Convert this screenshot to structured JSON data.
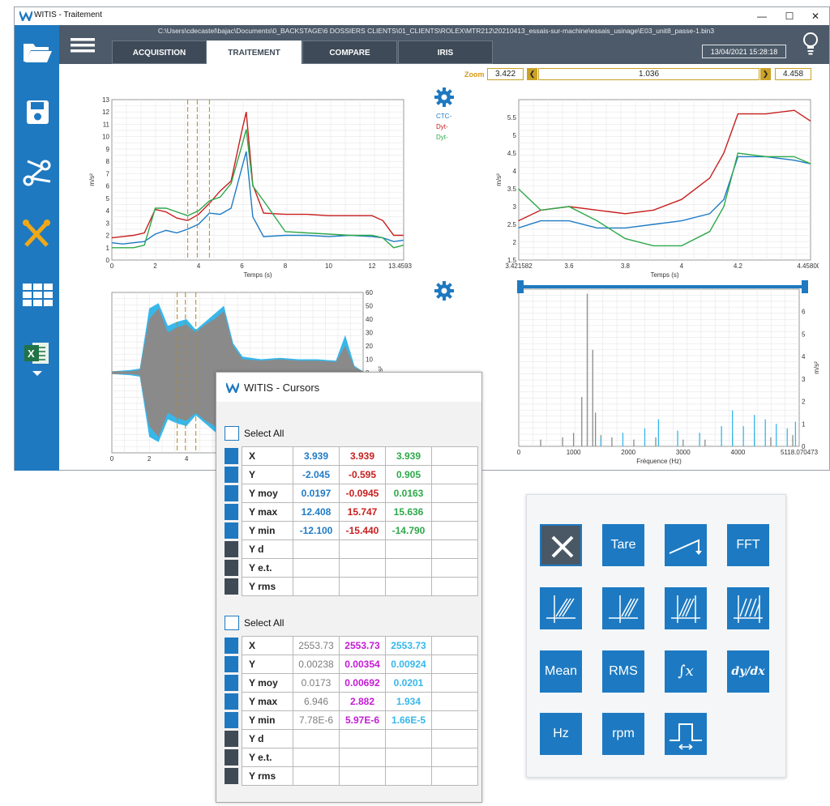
{
  "window": {
    "title": "WITIS - Traitement",
    "path": "C:\\Users\\cdecastel\\bajac\\Documents\\0_BACKSTAGE\\6 DOSSIERS CLIENTS\\01_CLIENTS\\ROLEX\\MTR212\\20210413_essais-sur-machine\\essais_usinage\\E03_unit8_passe-1.bin3",
    "datetime": "13/04/2021 15:28:18",
    "controls": {
      "minimize": "—",
      "maximize": "☐",
      "close": "✕"
    }
  },
  "tabs": [
    {
      "label": "ACQUISITION",
      "active": false
    },
    {
      "label": "TRAITEMENT",
      "active": true
    },
    {
      "label": "COMPARE",
      "active": false
    },
    {
      "label": "IRIS",
      "active": false
    }
  ],
  "sidebar": [
    {
      "icon": "folder-open-icon"
    },
    {
      "icon": "save-icon"
    },
    {
      "icon": "scissors-icon"
    },
    {
      "icon": "tools-icon"
    },
    {
      "icon": "grid-icon"
    },
    {
      "icon": "excel-icon"
    }
  ],
  "zoom": {
    "label": "Zoom",
    "left": "3.422",
    "center": "1.036",
    "right": "4.458"
  },
  "colors": {
    "blue": "#1f7bc6",
    "red": "#c81e1e",
    "green": "#2ea84a",
    "gray": "#8a8a8a",
    "magenta": "#c51ad6",
    "cyan": "#37b7ea",
    "accent": "#1f79c0",
    "gold": "#c9a227"
  },
  "chart_data": [
    {
      "type": "line",
      "name": "time-overview",
      "xlabel": "Temps (s)",
      "ylabel": "m/s²",
      "xlim": [
        0,
        13.459375
      ],
      "ylim": [
        0,
        13
      ],
      "xticks": [
        "0",
        "2",
        "4",
        "6",
        "8",
        "10",
        "12",
        "13.459375"
      ],
      "yticks": [
        "0",
        "1",
        "2",
        "3",
        "4",
        "5",
        "6",
        "7",
        "8",
        "9",
        "10",
        "11",
        "12",
        "13"
      ],
      "legend": [
        "CTC-",
        "Dyt-",
        "Dyt-"
      ],
      "cursor_lines_x": [
        3.5,
        3.939,
        4.5
      ],
      "series": [
        {
          "name": "CTC-",
          "color": "blue",
          "x": [
            0,
            0.5,
            1,
            1.5,
            2,
            2.5,
            3,
            3.5,
            4,
            4.5,
            5,
            5.5,
            6,
            6.2,
            6.5,
            7,
            8,
            9,
            10,
            11,
            12,
            12.5,
            13,
            13.45
          ],
          "y": [
            1.4,
            1.3,
            1.4,
            1.5,
            2.1,
            2.4,
            2.2,
            2.5,
            2.9,
            3.8,
            3.7,
            4.2,
            7.5,
            8.8,
            3.5,
            1.9,
            2.0,
            2.0,
            1.9,
            2.0,
            1.9,
            1.8,
            1.5,
            1.6
          ]
        },
        {
          "name": "Dyt-",
          "color": "red",
          "x": [
            0,
            0.5,
            1,
            1.5,
            2,
            2.5,
            3,
            3.5,
            4,
            4.5,
            5,
            5.5,
            6,
            6.2,
            6.5,
            7,
            8,
            9,
            10,
            11,
            12,
            12.5,
            13,
            13.45
          ],
          "y": [
            1.8,
            1.9,
            2.0,
            2.2,
            4.1,
            3.9,
            3.4,
            3.2,
            3.7,
            4.6,
            5.6,
            6.4,
            10.5,
            12.0,
            6.1,
            3.8,
            3.7,
            3.7,
            3.6,
            3.6,
            3.6,
            3.2,
            2.0,
            2.0
          ]
        },
        {
          "name": "Dyt-",
          "color": "green",
          "x": [
            0,
            0.5,
            1,
            1.5,
            2,
            2.5,
            3,
            3.5,
            4,
            4.5,
            5,
            5.5,
            6,
            6.2,
            6.5,
            7,
            8,
            9,
            10,
            11,
            12,
            12.5,
            13,
            13.45
          ],
          "y": [
            1.0,
            1.0,
            1.0,
            1.2,
            4.2,
            4.2,
            3.9,
            3.6,
            4.0,
            4.8,
            5.1,
            6.2,
            9.3,
            10.6,
            6.0,
            4.8,
            2.3,
            2.2,
            2.1,
            2.0,
            2.0,
            1.8,
            1.0,
            1.2
          ]
        }
      ]
    },
    {
      "type": "line",
      "name": "time-zoom",
      "xlabel": "Temps (s)",
      "ylabel": "m/s²",
      "xlim": [
        3.421582,
        4.458008
      ],
      "ylim": [
        1.5,
        6
      ],
      "xticks": [
        "3.421582",
        "3.6",
        "3.8",
        "4",
        "4.2",
        "4.458008"
      ],
      "yticks": [
        "1.5",
        "2",
        "2.5",
        "3",
        "3.5",
        "4",
        "4.5",
        "5",
        "5.5"
      ],
      "series": [
        {
          "name": "",
          "color": "red",
          "x": [
            3.42,
            3.5,
            3.6,
            3.7,
            3.8,
            3.9,
            4.0,
            4.1,
            4.15,
            4.2,
            4.3,
            4.4,
            4.458
          ],
          "y": [
            2.6,
            2.9,
            3.0,
            2.9,
            2.8,
            2.9,
            3.2,
            3.8,
            4.5,
            5.6,
            5.6,
            5.7,
            5.4
          ]
        },
        {
          "name": "",
          "color": "blue",
          "x": [
            3.42,
            3.5,
            3.6,
            3.7,
            3.8,
            3.9,
            4.0,
            4.1,
            4.15,
            4.2,
            4.3,
            4.4,
            4.458
          ],
          "y": [
            2.4,
            2.6,
            2.6,
            2.4,
            2.4,
            2.5,
            2.6,
            2.8,
            3.2,
            4.4,
            4.4,
            4.3,
            4.2
          ]
        },
        {
          "name": "",
          "color": "green",
          "x": [
            3.42,
            3.5,
            3.6,
            3.7,
            3.8,
            3.9,
            4.0,
            4.1,
            4.15,
            4.2,
            4.3,
            4.4,
            4.458
          ],
          "y": [
            3.5,
            2.9,
            3.0,
            2.6,
            2.1,
            1.9,
            1.9,
            2.3,
            3.0,
            4.5,
            4.4,
            4.4,
            4.2
          ]
        }
      ]
    },
    {
      "type": "area",
      "name": "signal",
      "ylabel": "m/s²",
      "xlim": [
        0,
        13.459375
      ],
      "ylim": [
        -60,
        60
      ],
      "xticks": [
        "0",
        "2",
        "4"
      ],
      "yticks_right": [
        "60",
        "50",
        "40",
        "30",
        "20",
        "10",
        "0",
        "-10"
      ],
      "series": [
        {
          "name": "",
          "color": "cyan",
          "x": [
            0,
            1,
            1.5,
            2,
            2.5,
            3,
            3.5,
            4,
            4.5,
            5,
            5.5,
            6,
            6.5,
            7,
            8,
            9,
            10,
            11,
            12,
            12.5,
            13,
            13.45
          ],
          "y": [
            1,
            2,
            3,
            48,
            52,
            35,
            38,
            40,
            32,
            38,
            44,
            50,
            22,
            12,
            10,
            11,
            10,
            10,
            9,
            28,
            5,
            1
          ]
        },
        {
          "name": "",
          "color": "gray",
          "x": [
            0,
            1,
            1.5,
            2,
            2.5,
            3,
            3.5,
            4,
            4.5,
            5,
            5.5,
            6,
            6.5,
            7,
            8,
            9,
            10,
            11,
            12,
            12.5,
            13,
            13.45
          ],
          "y": [
            1,
            1,
            2,
            40,
            48,
            30,
            34,
            36,
            30,
            36,
            40,
            46,
            20,
            10,
            9,
            10,
            9,
            9,
            8,
            20,
            4,
            1
          ]
        }
      ]
    },
    {
      "type": "bar",
      "name": "spectrum",
      "xlabel": "Fréquence (Hz)",
      "ylabel": "m/s²",
      "xlim": [
        0,
        5118.070473
      ],
      "ylim": [
        0,
        7
      ],
      "xticks": [
        "0",
        "1000",
        "2000",
        "3000",
        "4000",
        "5118.070473"
      ],
      "yticks_right": [
        "7",
        "6",
        "5",
        "4",
        "3",
        "2",
        "1",
        "0"
      ],
      "series": [
        {
          "name": "",
          "color": "gray",
          "x": [
            400,
            800,
            1000,
            1150,
            1250,
            1350,
            1400,
            1500,
            1700,
            2100,
            2500,
            3000,
            3400,
            3900,
            4300,
            4600,
            5000
          ],
          "y": [
            0.3,
            0.4,
            0.6,
            2.2,
            6.8,
            4.3,
            1.5,
            0.5,
            0.4,
            0.3,
            0.4,
            0.3,
            0.3,
            0.5,
            0.6,
            0.4,
            0.5
          ]
        },
        {
          "name": "",
          "color": "cyan",
          "x": [
            1500,
            1900,
            2300,
            2550,
            2900,
            3300,
            3700,
            3900,
            4100,
            4300,
            4500,
            4700,
            4900,
            5050
          ],
          "y": [
            0.4,
            0.6,
            0.8,
            1.2,
            0.7,
            0.6,
            0.9,
            1.6,
            0.9,
            1.4,
            1.2,
            1.0,
            0.8,
            1.1
          ]
        }
      ]
    }
  ],
  "cursors": {
    "title": "WITIS - Cursors",
    "select_all": "Select All",
    "table1": {
      "rows": [
        {
          "label": "X",
          "values": [
            "3.939",
            "3.939",
            "3.939"
          ],
          "checked": true
        },
        {
          "label": "Y",
          "values": [
            "-2.045",
            "-0.595",
            "0.905"
          ],
          "checked": true
        },
        {
          "label": "Y moy",
          "values": [
            "0.0197",
            "-0.0945",
            "0.0163"
          ],
          "checked": true
        },
        {
          "label": "Y max",
          "values": [
            "12.408",
            "15.747",
            "15.636"
          ],
          "checked": true
        },
        {
          "label": "Y min",
          "values": [
            "-12.100",
            "-15.440",
            "-14.790"
          ],
          "checked": true
        },
        {
          "label": "Y d",
          "values": [
            "",
            "",
            ""
          ],
          "checked": false
        },
        {
          "label": "Y e.t.",
          "values": [
            "",
            "",
            ""
          ],
          "checked": false
        },
        {
          "label": "Y rms",
          "values": [
            "",
            "",
            ""
          ],
          "checked": false
        }
      ],
      "colors": [
        "#1f7bc6",
        "#c81e1e",
        "#2ea84a"
      ]
    },
    "table2": {
      "rows": [
        {
          "label": "X",
          "values": [
            "2553.73",
            "2553.73",
            "2553.73"
          ],
          "checked": true
        },
        {
          "label": "Y",
          "values": [
            "0.00238",
            "0.00354",
            "0.00924"
          ],
          "checked": true
        },
        {
          "label": "Y moy",
          "values": [
            "0.0173",
            "0.00692",
            "0.0201"
          ],
          "checked": true
        },
        {
          "label": "Y max",
          "values": [
            "6.946",
            "2.882",
            "1.934"
          ],
          "checked": true
        },
        {
          "label": "Y min",
          "values": [
            "7.78E-6",
            "5.97E-6",
            "1.66E-5"
          ],
          "checked": true
        },
        {
          "label": "Y d",
          "values": [
            "",
            "",
            ""
          ],
          "checked": false
        },
        {
          "label": "Y e.t.",
          "values": [
            "",
            "",
            ""
          ],
          "checked": false
        },
        {
          "label": "Y rms",
          "values": [
            "",
            "",
            ""
          ],
          "checked": false
        }
      ],
      "colors": [
        "#7d7d7d",
        "#c51ad6",
        "#37b7ea"
      ]
    }
  },
  "toolbox": {
    "buttons": [
      {
        "label": "✕",
        "icon": "close-icon"
      },
      {
        "label": "Tare"
      },
      {
        "label": "",
        "icon": "ramp-icon"
      },
      {
        "label": "FFT"
      },
      {
        "label": "",
        "icon": "hatch-left-icon"
      },
      {
        "label": "",
        "icon": "hatch-center-icon"
      },
      {
        "label": "",
        "icon": "hatch-window-icon"
      },
      {
        "label": "",
        "icon": "hatch-between-icon"
      },
      {
        "label": "Mean"
      },
      {
        "label": "RMS"
      },
      {
        "label": "∫x",
        "icon": "integral-icon"
      },
      {
        "label": "dy/dx",
        "icon": "derivative-icon"
      },
      {
        "label": "Hz"
      },
      {
        "label": "rpm"
      },
      {
        "label": "",
        "icon": "pulse-icon"
      }
    ]
  }
}
